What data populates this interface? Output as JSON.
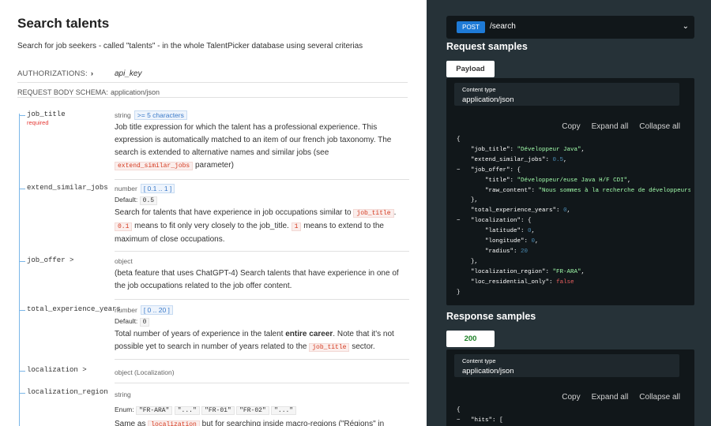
{
  "left": {
    "title": "Search talents",
    "description": "Search for job seekers - called \"talents\" - in the whole TalentPicker database using several criterias",
    "authorizations_label": "AUTHORIZATIONS:",
    "authorizations_value": "api_key",
    "schema_label": "REQUEST BODY SCHEMA:",
    "schema_value": "application/json",
    "props": {
      "job_title": {
        "name": "job_title",
        "required": "required",
        "type": "string",
        "constraint": ">= 5 characters",
        "desc_1": "Job title expression for which the talent has a professional experience. This expression is automatically matched to an item of our french job taxonomy. The search is extended to alternative names and similar jobs (see ",
        "desc_code": "extend_similar_jobs",
        "desc_2": " parameter)"
      },
      "extend_similar_jobs": {
        "name": "extend_similar_jobs",
        "type": "number",
        "constraint": "[ 0.1 .. 1 ]",
        "default_label": "Default:",
        "default_value": "0.5",
        "desc_1": "Search for talents that have experience in job occupations similar to ",
        "code_1": "job_title",
        "desc_2": ".",
        "code_2": "0.1",
        "desc_3": " means to fit only very closely to the job_title. ",
        "code_3": "1",
        "desc_4": " means to extend to the maximum of close occupations."
      },
      "job_offer": {
        "name": "job_offer",
        "chevron": ">",
        "type": "object",
        "desc": "(beta feature that uses ChatGPT-4) Search talents that have experience in one of the job occupations related to the job offer content."
      },
      "total_experience_years": {
        "name": "total_experience_years",
        "type": "number",
        "constraint": "[ 0 .. 20 ]",
        "default_label": "Default:",
        "default_value": "0",
        "desc_1": "Total number of years of experience in the talent ",
        "desc_bold": "entire career",
        "desc_2": ". Note that it's not possible yet to search in number of years related to the ",
        "code_1": "job_title",
        "desc_3": " sector."
      },
      "localization": {
        "name": "localization",
        "chevron": ">",
        "type": "object (Localization)"
      },
      "localization_region": {
        "name": "localization_region",
        "type": "string",
        "enum_label": "Enum:",
        "enum_values": [
          "\"FR-ARA\"",
          "\"...\"",
          "\"FR-01\"",
          "\"FR-02\"",
          "\"...\""
        ],
        "desc_1": "Same as ",
        "code_1": "localization",
        "desc_2": " but for searching inside macro-regions (\"Régions\" in"
      }
    }
  },
  "right": {
    "method": "POST",
    "path": "/search",
    "request_title": "Request samples",
    "request_tab": "Payload",
    "content_type_label": "Content type",
    "content_type_value": "application/json",
    "copy": "Copy",
    "expand_all": "Expand all",
    "collapse_all": "Collapse all",
    "response_title": "Response samples",
    "response_tab": "200",
    "request_json": {
      "open": "{",
      "job_title_key": "\"job_title\"",
      "job_title_val": "\"Développeur Java\"",
      "extend_key": "\"extend_similar_jobs\"",
      "extend_val": "0.5",
      "toggle": "−",
      "job_offer_key": "\"job_offer\"",
      "title_key": "\"title\"",
      "title_val": "\"Développeur/euse Java H/F CDI\"",
      "raw_key": "\"raw_content\"",
      "raw_val": "\"Nous sommes à la recherche de développeurs pa",
      "close_obj": "},",
      "total_key": "\"total_experience_years\"",
      "total_val": "0",
      "loc_key": "\"localization\"",
      "lat_key": "\"latitude\"",
      "lat_val": "0",
      "lon_key": "\"longitude\"",
      "lon_val": "0",
      "rad_key": "\"radius\"",
      "rad_val": "20",
      "region_key": "\"localization_region\"",
      "region_val": "\"FR-ARA\"",
      "resid_key": "\"loc_residential_only\"",
      "resid_val": "false",
      "close": "}"
    },
    "response_json": {
      "open": "{",
      "hits_key": "\"hits\"",
      "hits_open": "["
    }
  }
}
